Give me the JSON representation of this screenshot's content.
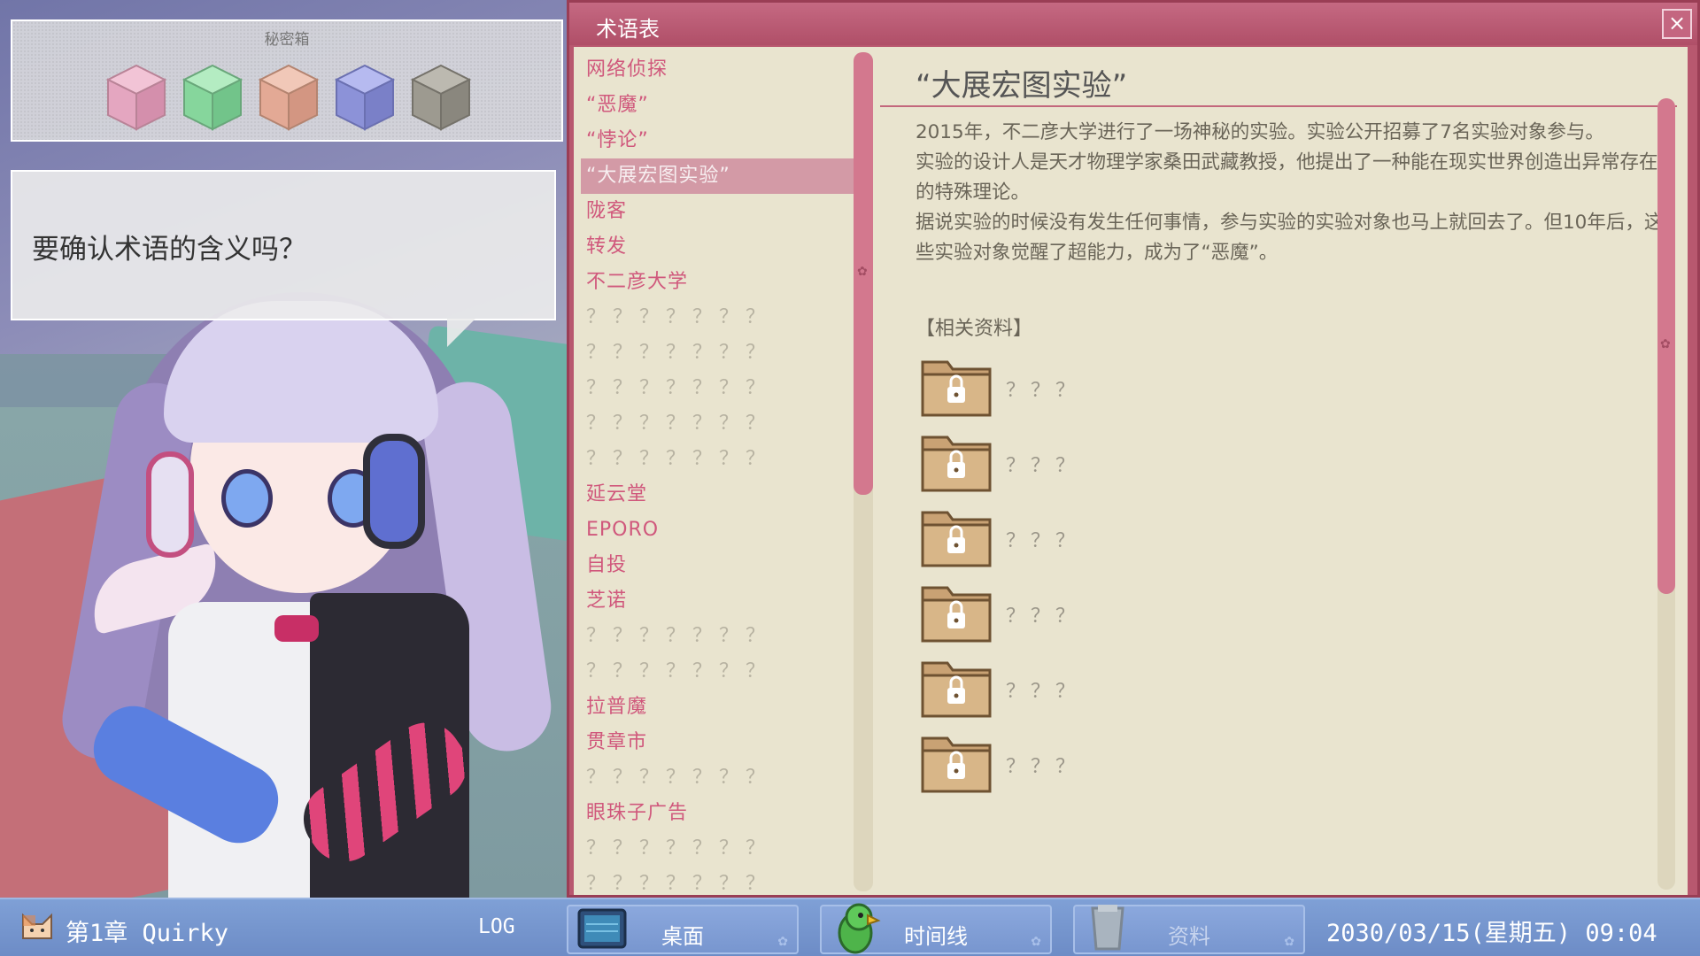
{
  "secret_box": {
    "title": "秘密箱",
    "cubes": [
      {
        "name": "pink-cube-icon",
        "color": "#e4a6c0"
      },
      {
        "name": "green-cube-icon",
        "color": "#86d69c"
      },
      {
        "name": "peach-cube-icon",
        "color": "#e3a995"
      },
      {
        "name": "blue-cube-icon",
        "color": "#8c92d8"
      },
      {
        "name": "gray-cube-icon",
        "color": "#9d9a90"
      }
    ]
  },
  "dialog": {
    "text": "要确认术语的含义吗？"
  },
  "glossary": {
    "title": "术语表",
    "close_icon": "×",
    "terms": [
      {
        "label": "网络侦探",
        "state": "known"
      },
      {
        "label": "“恶魔”",
        "state": "known"
      },
      {
        "label": "“悖论”",
        "state": "known"
      },
      {
        "label": "“大展宏图实验”",
        "state": "selected"
      },
      {
        "label": "陇客",
        "state": "known"
      },
      {
        "label": "转发",
        "state": "known"
      },
      {
        "label": "不二彦大学",
        "state": "known"
      },
      {
        "label": "？？？？？？？",
        "state": "unknown"
      },
      {
        "label": "？？？？？？？",
        "state": "unknown"
      },
      {
        "label": "？？？？？？？",
        "state": "unknown"
      },
      {
        "label": "？？？？？？？",
        "state": "unknown"
      },
      {
        "label": "？？？？？？？",
        "state": "unknown"
      },
      {
        "label": "延云堂",
        "state": "known"
      },
      {
        "label": "EPORO",
        "state": "known"
      },
      {
        "label": "自投",
        "state": "known"
      },
      {
        "label": "芝诺",
        "state": "known"
      },
      {
        "label": "？？？？？？？",
        "state": "unknown"
      },
      {
        "label": "？？？？？？？",
        "state": "unknown"
      },
      {
        "label": "拉普魔",
        "state": "known"
      },
      {
        "label": "贯章市",
        "state": "known"
      },
      {
        "label": "？？？？？？？",
        "state": "unknown"
      },
      {
        "label": "眼珠子广告",
        "state": "known"
      },
      {
        "label": "？？？？？？？",
        "state": "unknown"
      },
      {
        "label": "？？？？？？？",
        "state": "unknown"
      }
    ],
    "detail": {
      "title": "“大展宏图实验”",
      "paragraphs": [
        "2015年，不二彦大学进行了一场神秘的实验。实验公开招募了7名实验对象参与。",
        "实验的设计人是天才物理学家桑田武藏教授，他提出了一种能在现实世界创造出异常存在的特殊理论。",
        "据说实验的时候没有发生任何事情，参与实验的实验对象也马上就回去了。但10年后，这些实验对象觉醒了超能力，成为了“恶魔”。"
      ],
      "related_title": "【相关资料】",
      "related_files": [
        {
          "label": "？？？",
          "locked": true
        },
        {
          "label": "？？？",
          "locked": true
        },
        {
          "label": "？？？",
          "locked": true
        },
        {
          "label": "？？？",
          "locked": true
        },
        {
          "label": "？？？",
          "locked": true
        },
        {
          "label": "？？？",
          "locked": true
        }
      ]
    }
  },
  "taskbar": {
    "chapter": "第1章 Quirky",
    "log": "LOG",
    "buttons": [
      {
        "label": "桌面",
        "icon": "desktop-icon"
      },
      {
        "label": "时间线",
        "icon": "parrot-icon"
      },
      {
        "label": "资料",
        "icon": "document-icon",
        "disabled": true
      }
    ],
    "datetime": "2030/03/15(星期五) 09:04"
  },
  "colors": {
    "window_frame": "#b8586f",
    "panel_bg": "#e9e4cf",
    "term_text": "#d0587c",
    "taskbar": "#7896cf"
  }
}
